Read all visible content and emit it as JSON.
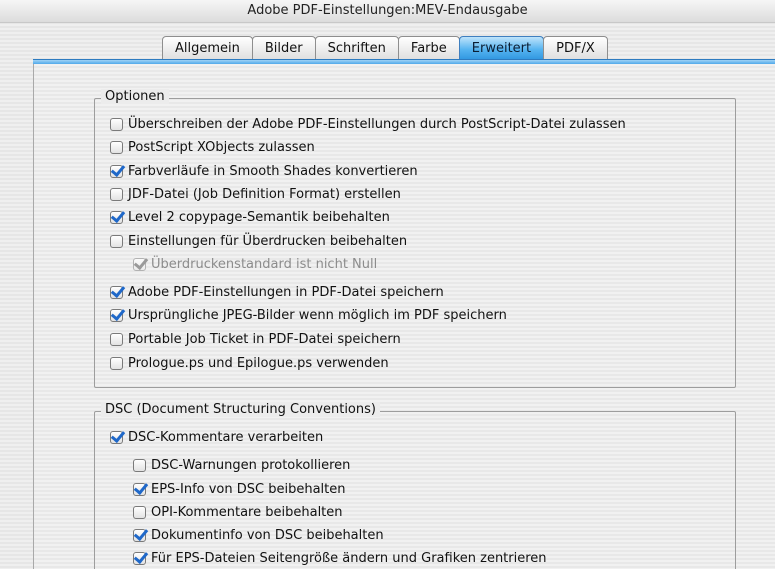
{
  "window": {
    "title": "Adobe PDF-Einstellungen:MEV-Endausgabe"
  },
  "tabs": [
    {
      "label": "Allgemein",
      "active": false
    },
    {
      "label": "Bilder",
      "active": false
    },
    {
      "label": "Schriften",
      "active": false
    },
    {
      "label": "Farbe",
      "active": false
    },
    {
      "label": "Erweitert",
      "active": true
    },
    {
      "label": "PDF/X",
      "active": false
    }
  ],
  "colors": {
    "accent": "#3d9fe6",
    "check": "#1f68c9"
  },
  "optionen": {
    "label": "Optionen",
    "items": [
      {
        "label": "Überschreiben der Adobe PDF-Einstellungen durch PostScript-Datei zulassen",
        "checked": false,
        "enabled": true
      },
      {
        "label": "PostScript XObjects zulassen",
        "checked": false,
        "enabled": true
      },
      {
        "label": "Farbverläufe in Smooth Shades konvertieren",
        "checked": true,
        "enabled": true
      },
      {
        "label": "JDF-Datei (Job Definition Format) erstellen",
        "checked": false,
        "enabled": true
      },
      {
        "label": "Level 2 copypage-Semantik beibehalten",
        "checked": true,
        "enabled": true
      },
      {
        "label": "Einstellungen für Überdrucken beibehalten",
        "checked": false,
        "enabled": true
      },
      {
        "label": "Überdruckenstandard ist nicht Null",
        "checked": true,
        "enabled": false
      },
      {
        "label": "Adobe PDF-Einstellungen in PDF-Datei speichern",
        "checked": true,
        "enabled": true
      },
      {
        "label": "Ursprüngliche JPEG-Bilder wenn möglich im PDF speichern",
        "checked": true,
        "enabled": true
      },
      {
        "label": "Portable Job Ticket in PDF-Datei speichern",
        "checked": false,
        "enabled": true
      },
      {
        "label": "Prologue.ps und Epilogue.ps verwenden",
        "checked": false,
        "enabled": true
      }
    ]
  },
  "dsc": {
    "label": "DSC (Document Structuring Conventions)",
    "items": [
      {
        "label": "DSC-Kommentare verarbeiten",
        "checked": true,
        "enabled": true
      },
      {
        "label": "DSC-Warnungen protokollieren",
        "checked": false,
        "enabled": true
      },
      {
        "label": "EPS-Info von DSC beibehalten",
        "checked": true,
        "enabled": true
      },
      {
        "label": "OPI-Kommentare beibehalten",
        "checked": false,
        "enabled": true
      },
      {
        "label": "Dokumentinfo von DSC beibehalten",
        "checked": true,
        "enabled": true
      },
      {
        "label": "Für EPS-Dateien Seitengröße ändern und Grafiken zentrieren",
        "checked": true,
        "enabled": true
      }
    ]
  }
}
